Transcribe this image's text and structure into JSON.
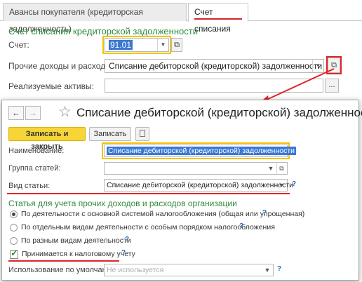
{
  "tabs": [
    {
      "label": "Авансы покупателя (кредиторская задолженность)"
    },
    {
      "label": "Счет списания"
    }
  ],
  "top_form": {
    "section_title": "Счет списания кредиторской задолженности",
    "account_label": "Счет:",
    "account_value": "91.01",
    "other_income_label": "Прочие доходы и расходы:",
    "other_income_value": "Списание дебиторской (кредиторской) задолженности",
    "realized_assets_label": "Реализуемые активы:",
    "realized_assets_value": "",
    "dots_label": "..."
  },
  "popup": {
    "back_arrow": "←",
    "forward_arrow": "→",
    "star": "☆",
    "title": "Списание дебиторской (кредиторской) задолженности",
    "save_close_label": "Записать и закрыть",
    "save_label": "Записать",
    "name_label": "Наименование:",
    "name_value": "Списание дебиторской (кредиторской) задолженности",
    "group_label": "Группа статей:",
    "group_value": "",
    "type_label": "Вид статьи:",
    "type_value": "Списание дебиторской (кредиторской) задолженности",
    "accounting_title": "Статья для учета прочих доходов и расходов организации",
    "radio_options": [
      {
        "label": "По деятельности с основной системой налогообложения (общая или упрощенная)",
        "selected": true
      },
      {
        "label": "По отдельным видам деятельности с особым порядком налогообложения",
        "selected": false
      },
      {
        "label": "По разным видам деятельности",
        "selected": false
      }
    ],
    "tax_checkbox_label": "Принимается к налоговому учету",
    "tax_checked": true,
    "default_use_label": "Использование по умолчанию:",
    "default_use_placeholder": "Не используется",
    "question_mark": "?"
  },
  "colors": {
    "accent_green": "#2e8b3a",
    "highlight_red": "#e0252a",
    "highlight_yellow": "#f2c200",
    "primary_button": "#f7d537",
    "selection_blue": "#3a78d4",
    "help_blue": "#2a64c8"
  }
}
